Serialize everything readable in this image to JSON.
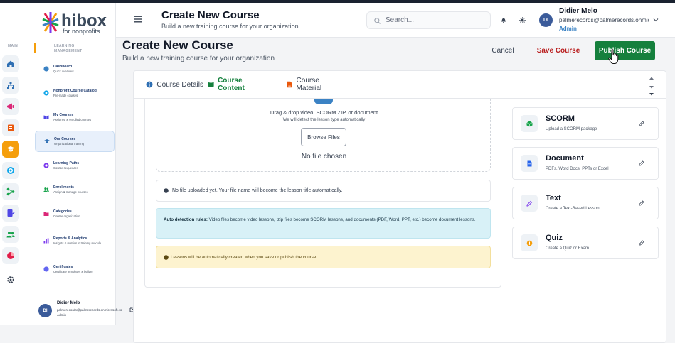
{
  "brand": {
    "name": "hibox",
    "tagline": "for nonprofits"
  },
  "rail": {
    "section_label": "MAIN"
  },
  "menu": {
    "section_title_1": "LEARNING",
    "section_title_2": "MANAGEMENT",
    "items": [
      {
        "title": "Dashboard",
        "subtitle": "Quick overview"
      },
      {
        "title": "Nonprofit Course Catalog",
        "subtitle": "Pre-made courses"
      },
      {
        "title": "My Courses",
        "subtitle": "Assigned & enrolled courses"
      },
      {
        "title": "Our Courses",
        "subtitle": "Organizational training"
      },
      {
        "title": "Learning Paths",
        "subtitle": "Course sequences"
      },
      {
        "title": "Enrollments",
        "subtitle": "Assign & manage courses"
      },
      {
        "title": "Categories",
        "subtitle": "Course organization"
      },
      {
        "title": "Reports & Analytics",
        "subtitle": "Insights & metrics in training module"
      },
      {
        "title": "Certificates",
        "subtitle": "Certificate templates & builder"
      }
    ]
  },
  "user": {
    "initials": "DI",
    "name": "Didier Melo",
    "email": "palmerecords@palmerecords.onmicrosoft.com",
    "role": "Admin"
  },
  "header": {
    "title": "Create New Course",
    "subtitle": "Build a new training course for your organization",
    "search_placeholder": "Search..."
  },
  "page": {
    "title": "Create New Course",
    "subtitle": "Build a new training course for your organization",
    "cancel_label": "Cancel",
    "save_label": "Save Course",
    "publish_label": "Publish Course"
  },
  "tabs": [
    {
      "label": "Course Details",
      "icon": "info-icon",
      "active": false
    },
    {
      "label": "Course Content",
      "icon": "book-icon",
      "active": true
    },
    {
      "label": "Course Material",
      "icon": "file-icon",
      "active": false
    }
  ],
  "upload": {
    "drop_title": "Drag & drop video, SCORM ZIP, or document",
    "drop_subtitle": "We will detect the lesson type automatically",
    "browse_label": "Browse Files",
    "no_file": "No file chosen"
  },
  "notices": {
    "no_upload": "No file uploaded yet. Your file name will become the lesson title automatically.",
    "auto_detect_label": "Auto detection rules:",
    "auto_detect_text": "Video files become video lessons, .zip files become SCORM lessons, and documents (PDF, Word, PPT, etc.) become document lessons.",
    "auto_create": "Lessons will be automatically created when you save or publish the course."
  },
  "lesson_types": [
    {
      "title": "SCORM",
      "subtitle": "Upload a SCORM package",
      "icon": "package-icon",
      "color": "#16a34a"
    },
    {
      "title": "Document",
      "subtitle": "PDFs, Word Docs, PPTs or Excel",
      "icon": "document-icon",
      "color": "#2563eb"
    },
    {
      "title": "Text",
      "subtitle": "Create a Text-Based Lesson",
      "icon": "pencil-icon",
      "color": "#7c3aed"
    },
    {
      "title": "Quiz",
      "subtitle": "Create a Quiz or Exam",
      "icon": "lightbulb-icon",
      "color": "#f59e0b"
    }
  ],
  "colors": {
    "accent": "#15803d",
    "danger": "#b91c1c",
    "link": "#3b82c4",
    "rail_active": "#f59e0b"
  }
}
